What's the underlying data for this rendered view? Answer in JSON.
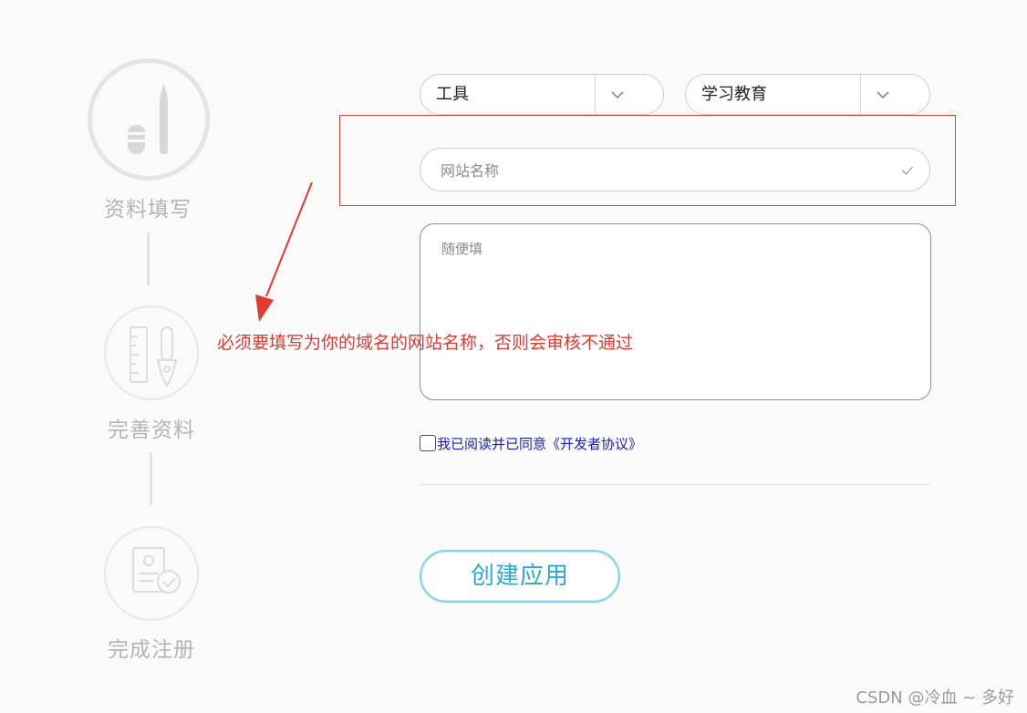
{
  "steps": [
    {
      "label": "资料填写",
      "icon": "pencil-icon",
      "state": "active"
    },
    {
      "label": "完善资料",
      "icon": "ruler-pen-icon",
      "state": "pending"
    },
    {
      "label": "完成注册",
      "icon": "document-check-icon",
      "state": "pending"
    }
  ],
  "form": {
    "category": {
      "value": "工具",
      "icon": "chevron-down-icon"
    },
    "subcategory": {
      "value": "学习教育",
      "icon": "chevron-down-icon"
    },
    "site_name": {
      "placeholder": "网站名称",
      "value": ""
    },
    "description": {
      "placeholder": "随便填",
      "value": ""
    },
    "agreement": {
      "label": "我已阅读并已同意《开发者协议》",
      "checked": false
    },
    "submit_label": "创建应用"
  },
  "annotation": {
    "text": "必须要填写为你的域名的网站名称，否则会审核不通过",
    "color": "#e03a32"
  },
  "watermark": "CSDN @冷血 ~ 多好",
  "colors": {
    "accent": "#2fa8d6",
    "link": "#1c1cbf",
    "annotation": "#e03a32",
    "step_label": "#b4b4b4"
  }
}
